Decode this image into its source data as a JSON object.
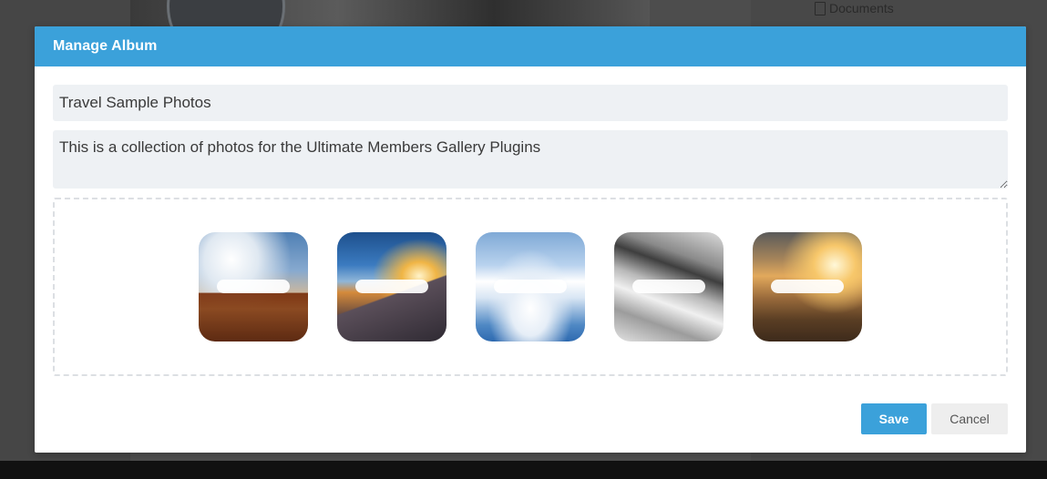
{
  "background": {
    "sidebar_item": "Documents"
  },
  "modal": {
    "title": "Manage Album",
    "album_title_value": "Travel Sample Photos",
    "description_value": "This is a collection of photos for the Ultimate Members Gallery Plugins",
    "photos": [
      {
        "name": "canyon-photo"
      },
      {
        "name": "road-sunset-photo"
      },
      {
        "name": "clouds-photo"
      },
      {
        "name": "snow-rock-photo"
      },
      {
        "name": "desert-road-photo"
      }
    ],
    "save_label": "Save",
    "cancel_label": "Cancel"
  },
  "colors": {
    "accent": "#3ba1da",
    "field_bg": "#eef1f4",
    "cancel_bg": "#eeeeee"
  }
}
